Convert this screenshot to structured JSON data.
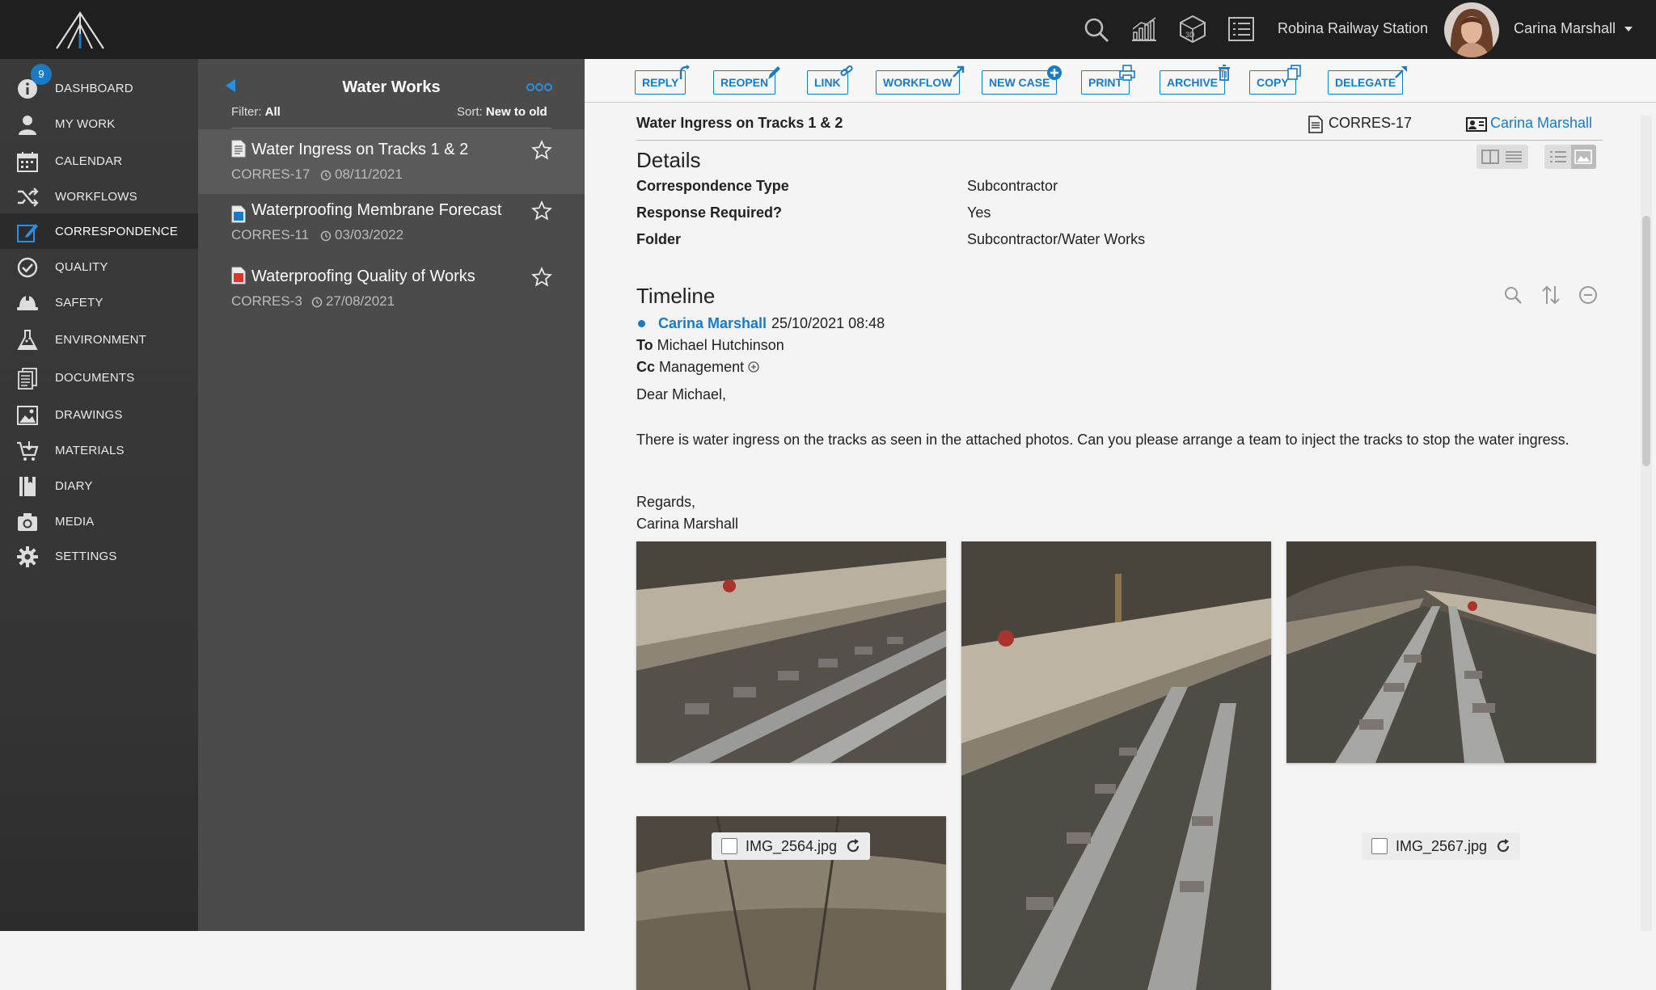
{
  "header": {
    "project": "Robina Railway Station",
    "user": "Carina Marshall",
    "icons": [
      "search-icon",
      "analytics-icon",
      "3d-model-icon",
      "list-icon"
    ]
  },
  "sidebar": {
    "badge": "9",
    "items": [
      {
        "label": "DASHBOARD",
        "icon": "info-icon"
      },
      {
        "label": "MY WORK",
        "icon": "user-icon"
      },
      {
        "label": "CALENDAR",
        "icon": "calendar-icon"
      },
      {
        "label": "WORKFLOWS",
        "icon": "shuffle-icon"
      },
      {
        "label": "CORRESPONDENCE",
        "icon": "edit-icon"
      },
      {
        "label": "QUALITY",
        "icon": "check-circle-icon"
      },
      {
        "label": "SAFETY",
        "icon": "hard-hat-icon"
      },
      {
        "label": "ENVIRONMENT",
        "icon": "flask-icon"
      },
      {
        "label": "DOCUMENTS",
        "icon": "documents-icon"
      },
      {
        "label": "DRAWINGS",
        "icon": "image-icon"
      },
      {
        "label": "MATERIALS",
        "icon": "cart-icon"
      },
      {
        "label": "DIARY",
        "icon": "book-icon"
      },
      {
        "label": "MEDIA",
        "icon": "camera-icon"
      },
      {
        "label": "SETTINGS",
        "icon": "gear-icon"
      }
    ],
    "active": "CORRESPONDENCE"
  },
  "list": {
    "title": "Water Works",
    "filter_label": "Filter:",
    "filter_value": "All",
    "sort_label": "Sort:",
    "sort_value": "New to old",
    "items": [
      {
        "title": "Water Ingress on Tracks 1 & 2",
        "ref": "CORRES-17",
        "date": "08/11/2021"
      },
      {
        "title": "Waterproofing Membrane Forecast",
        "ref": "CORRES-11",
        "date": "03/03/2022"
      },
      {
        "title": "Waterproofing Quality of Works",
        "ref": "CORRES-3",
        "date": "27/08/2021"
      }
    ]
  },
  "toolbar": {
    "buttons": [
      "REPLY",
      "REOPEN",
      "LINK",
      "WORKFLOW",
      "NEW CASE",
      "PRINT",
      "ARCHIVE",
      "COPY",
      "DELEGATE"
    ]
  },
  "record": {
    "title": "Water Ingress on Tracks 1 & 2",
    "ref": "CORRES-17",
    "owner": "Carina Marshall"
  },
  "details": {
    "heading": "Details",
    "rows": [
      {
        "label": "Correspondence Type",
        "value": "Subcontractor"
      },
      {
        "label": "Response Required?",
        "value": "Yes"
      },
      {
        "label": "Folder",
        "value": "Subcontractor/Water Works"
      }
    ]
  },
  "timeline": {
    "heading": "Timeline",
    "author": "Carina Marshall",
    "datetime": "25/10/2021 08:48",
    "to_label": "To",
    "to": "Michael Hutchinson",
    "cc_label": "Cc",
    "cc": "Management",
    "greeting": "Dear Michael,",
    "body": "There is water ingress on the tracks as seen in the attached photos. Can you please arrange a team to inject the tracks to stop the water ingress.",
    "signoff": "Regards,",
    "signature": "Carina Marshall",
    "attachments": [
      "IMG_2564.jpg",
      "IMG_2567.jpg"
    ]
  },
  "colors": {
    "accent": "#1b7ac4",
    "topbar": "#1f1f1f",
    "sidebar": "#3a3a3a",
    "listpane": "#4b4b4b"
  }
}
